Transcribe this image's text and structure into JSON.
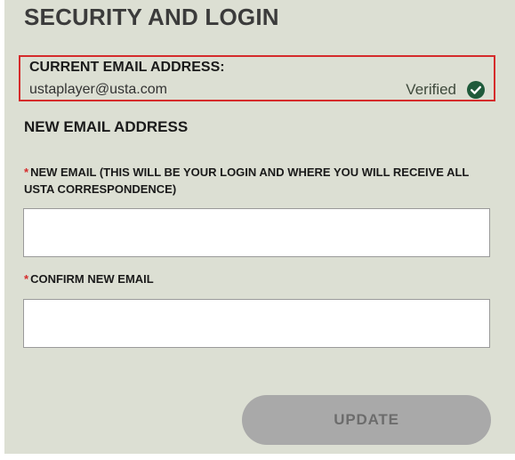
{
  "page": {
    "title": "SECURITY AND LOGIN"
  },
  "current_email": {
    "label": "CURRENT EMAIL ADDRESS:",
    "value": "ustaplayer@usta.com",
    "status": "Verified",
    "status_icon": "check-circle-icon",
    "status_color": "#1f5a3a"
  },
  "new_email_section": {
    "heading": "NEW EMAIL ADDRESS",
    "required_marker": "*",
    "new_email_label": "NEW EMAIL (THIS WILL BE YOUR LOGIN AND WHERE YOU WILL RECEIVE ALL USTA CORRESPONDENCE)",
    "new_email_value": "",
    "confirm_email_label": "CONFIRM NEW EMAIL",
    "confirm_email_value": ""
  },
  "actions": {
    "update_label": "UPDATE",
    "update_enabled": false
  },
  "colors": {
    "panel_background": "#dcdfd3",
    "highlight_border": "#d52b2b",
    "button_disabled": "#a9a9a9"
  }
}
